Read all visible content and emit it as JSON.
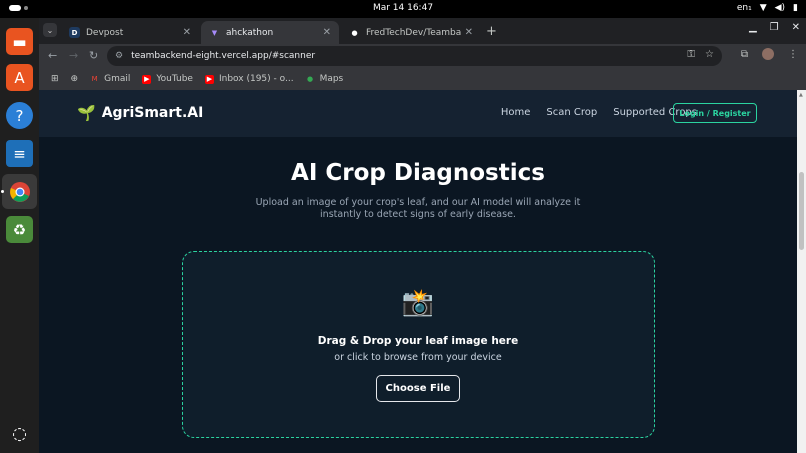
{
  "system": {
    "clock": "Mar 14  16:47",
    "input_lang": "en₁"
  },
  "dock": {
    "apps": [
      {
        "name": "files",
        "glyph": "▬"
      },
      {
        "name": "app-center",
        "glyph": "A"
      },
      {
        "name": "help",
        "glyph": "?"
      },
      {
        "name": "writer",
        "glyph": "≡"
      },
      {
        "name": "chrome",
        "glyph": "◉"
      },
      {
        "name": "trash",
        "glyph": "♻"
      }
    ]
  },
  "browser": {
    "tabs": [
      {
        "title": "Devpost",
        "favicon": "D"
      },
      {
        "title": "ahckathon",
        "favicon": "▼"
      },
      {
        "title": "FredTechDev/Teambacke",
        "favicon": "●"
      }
    ],
    "url": "teambackend-eight.vercel.app/#scanner",
    "bookmarks": [
      {
        "label": "Gmail",
        "icon": "M",
        "color": "#ea4335"
      },
      {
        "label": "YouTube",
        "icon": "▶",
        "color": "#ff0000"
      },
      {
        "label": "Inbox (195) - o...",
        "icon": "▶",
        "color": "#ff0000"
      },
      {
        "label": "Maps",
        "icon": "●",
        "color": "#34a853"
      }
    ]
  },
  "site": {
    "brand": "AgriSmart.AI",
    "nav": [
      "Home",
      "Scan Crop",
      "Supported Crops"
    ],
    "login": "Login / Register",
    "hero_title": "AI Crop Diagnostics",
    "hero_sub": "Upload an image of your crop's leaf, and our AI model will analyze it instantly to detect signs of early disease.",
    "dropzone": {
      "icon": "📸",
      "title": "Drag & Drop your leaf image here",
      "subtitle": "or click to browse from your device",
      "button": "Choose File"
    },
    "accent": "#2bd4a0"
  }
}
